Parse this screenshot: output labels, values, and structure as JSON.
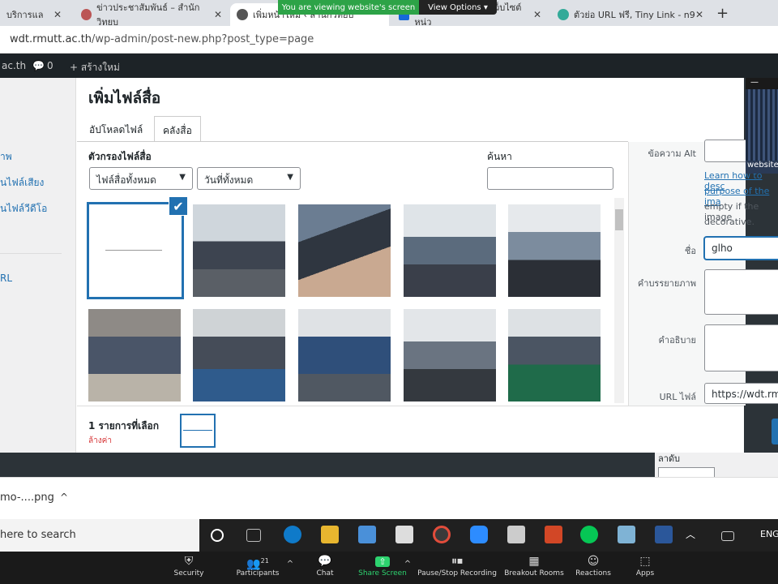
{
  "browser": {
    "tabs": [
      {
        "label": "บริการแล"
      },
      {
        "label": "ข่าวประชาสัมพันธ์ – สำนักวิทยบ"
      },
      {
        "label": "เพิ่มหน้าใหม่ ‹ สำนักวิทยบ"
      },
      {
        "label": "เว็บไซต์หน่วยงาน ‹ เว็บไซต์หน่ว"
      },
      {
        "label": "ตัวย่อ URL ฟรี, Tiny Link - n9"
      }
    ],
    "new_tab": "+",
    "url_host": "wdt.rmutt.ac.th",
    "url_path": "/wp-admin/post-new.php?post_type=page"
  },
  "zoom_banner": {
    "viewing": "You are viewing website's screen",
    "view_options": "View Options"
  },
  "wp_admin_bar": {
    "site": "ac.th",
    "comments": "0",
    "new": "+ สร้างใหม่"
  },
  "media_modal": {
    "title": "เพิ่มไฟล์สื่อ",
    "tabs": [
      "อัปโหลดไฟล์",
      "คลังสื่อ"
    ],
    "left_menu": [
      "าพ",
      "นไฟล์เสียง",
      "นไฟล์วีดีโอ",
      "RL"
    ],
    "filter_label": "ตัวกรองไฟล์สื่อ",
    "filter_type": "ไฟล์สื่อทั้งหมด",
    "filter_date": "วันที่ทั้งหมด",
    "search_label": "ค้นหา",
    "search_value": ""
  },
  "details_panel": {
    "alt_label": "ข้อความ Alt",
    "help_link": "Learn how to desc",
    "help_link2": "purpose of the ima",
    "help_note": "empty if the image",
    "help_note2": "decorative.",
    "name_label": "ชื่อ",
    "name_value": "glho",
    "caption_label": "คำบรรยายภาพ",
    "desc_label": "คำอธิบาย",
    "url_label": "URL ไฟล์",
    "url_value": "https://wdt.rmu"
  },
  "selection_toolbar": {
    "count": "1 รายการที่เลือก",
    "clear": "ล้างค่า"
  },
  "page_sidebar": {
    "label": "ลาดับ"
  },
  "downloads": {
    "file": "mo-....png",
    "caret": "^"
  },
  "taskbar": {
    "search": "here to search",
    "lang": "ENG"
  },
  "webcam": {
    "label": "website"
  },
  "zoom_toolbar": {
    "security": "Security",
    "participants": "Participants",
    "participants_count": "21",
    "chat": "Chat",
    "share_screen": "Share Screen",
    "pause_recording": "Pause/Stop Recording",
    "breakout": "Breakout Rooms",
    "reactions": "Reactions",
    "apps": "Apps"
  },
  "colors": {
    "wp_blue": "#2271b1",
    "zoom_green": "#2da347",
    "admin_bar": "#1d2327"
  }
}
